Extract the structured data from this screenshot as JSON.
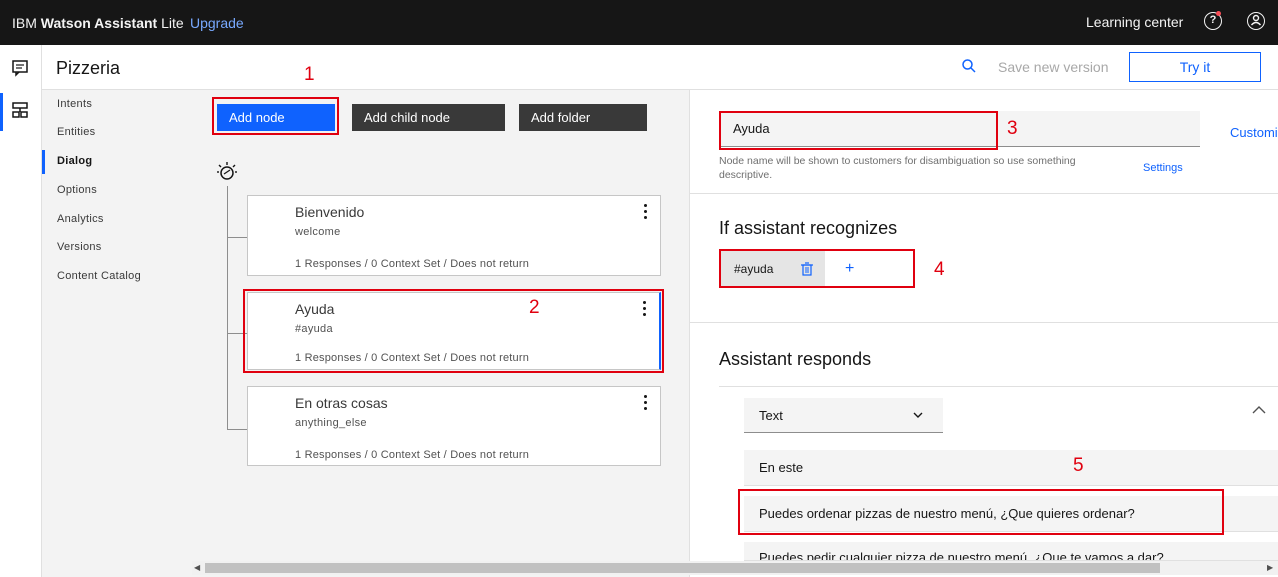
{
  "topbar": {
    "brand_prefix": "IBM",
    "brand_bold": "Watson Assistant",
    "brand_suffix": "Lite",
    "upgrade": "Upgrade",
    "learning_center": "Learning center",
    "help_icon": "help-icon",
    "user_icon": "user-icon"
  },
  "header": {
    "title": "Pizzeria",
    "save_version": "Save new version",
    "try_it": "Try it"
  },
  "sidenav": {
    "items": [
      "Intents",
      "Entities",
      "Dialog",
      "Options",
      "Analytics",
      "Versions",
      "Content Catalog"
    ],
    "active": "Dialog"
  },
  "toolbar": {
    "add_node": "Add node",
    "add_child_node": "Add child node",
    "add_folder": "Add folder"
  },
  "nodes": [
    {
      "title": "Bienvenido",
      "condition": "welcome",
      "meta": "1 Responses / 0 Context Set / Does not return"
    },
    {
      "title": "Ayuda",
      "condition": "#ayuda",
      "meta": "1 Responses / 0 Context Set / Does not return"
    },
    {
      "title": "En otras cosas",
      "condition": "anything_else",
      "meta": "1 Responses / 0 Context Set / Does not return"
    }
  ],
  "annotations": [
    "1",
    "2",
    "3",
    "4",
    "5"
  ],
  "editor": {
    "node_name": "Ayuda",
    "customize": "Customiz",
    "help_text": "Node name will be shown to customers for disambiguation so use something descriptive.",
    "settings": "Settings",
    "recognizes_title": "If assistant recognizes",
    "intent": "#ayuda",
    "add_condition": "+",
    "responds_title": "Assistant responds",
    "response_type": "Text",
    "responses": [
      "En este",
      "Puedes ordenar pizzas de nuestro menú, ¿Que quieres ordenar?",
      "Puedes pedir cualquier pizza de nuestro menú, ¿Que te vamos a dar?"
    ]
  },
  "colors": {
    "accent": "#0f62fe",
    "annotation": "#e0000f",
    "topbar": "#161616"
  }
}
